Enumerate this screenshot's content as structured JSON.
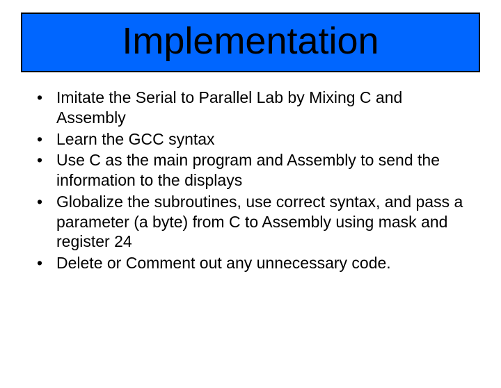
{
  "title": "Implementation",
  "bullets": [
    "Imitate the Serial to Parallel Lab by Mixing C and Assembly",
    "Learn the GCC syntax",
    "Use C as the main program and Assembly to send the information to the displays",
    "Globalize the subroutines, use correct syntax, and pass a parameter (a byte) from C to Assembly using mask and register 24",
    "Delete or Comment out any unnecessary code."
  ]
}
